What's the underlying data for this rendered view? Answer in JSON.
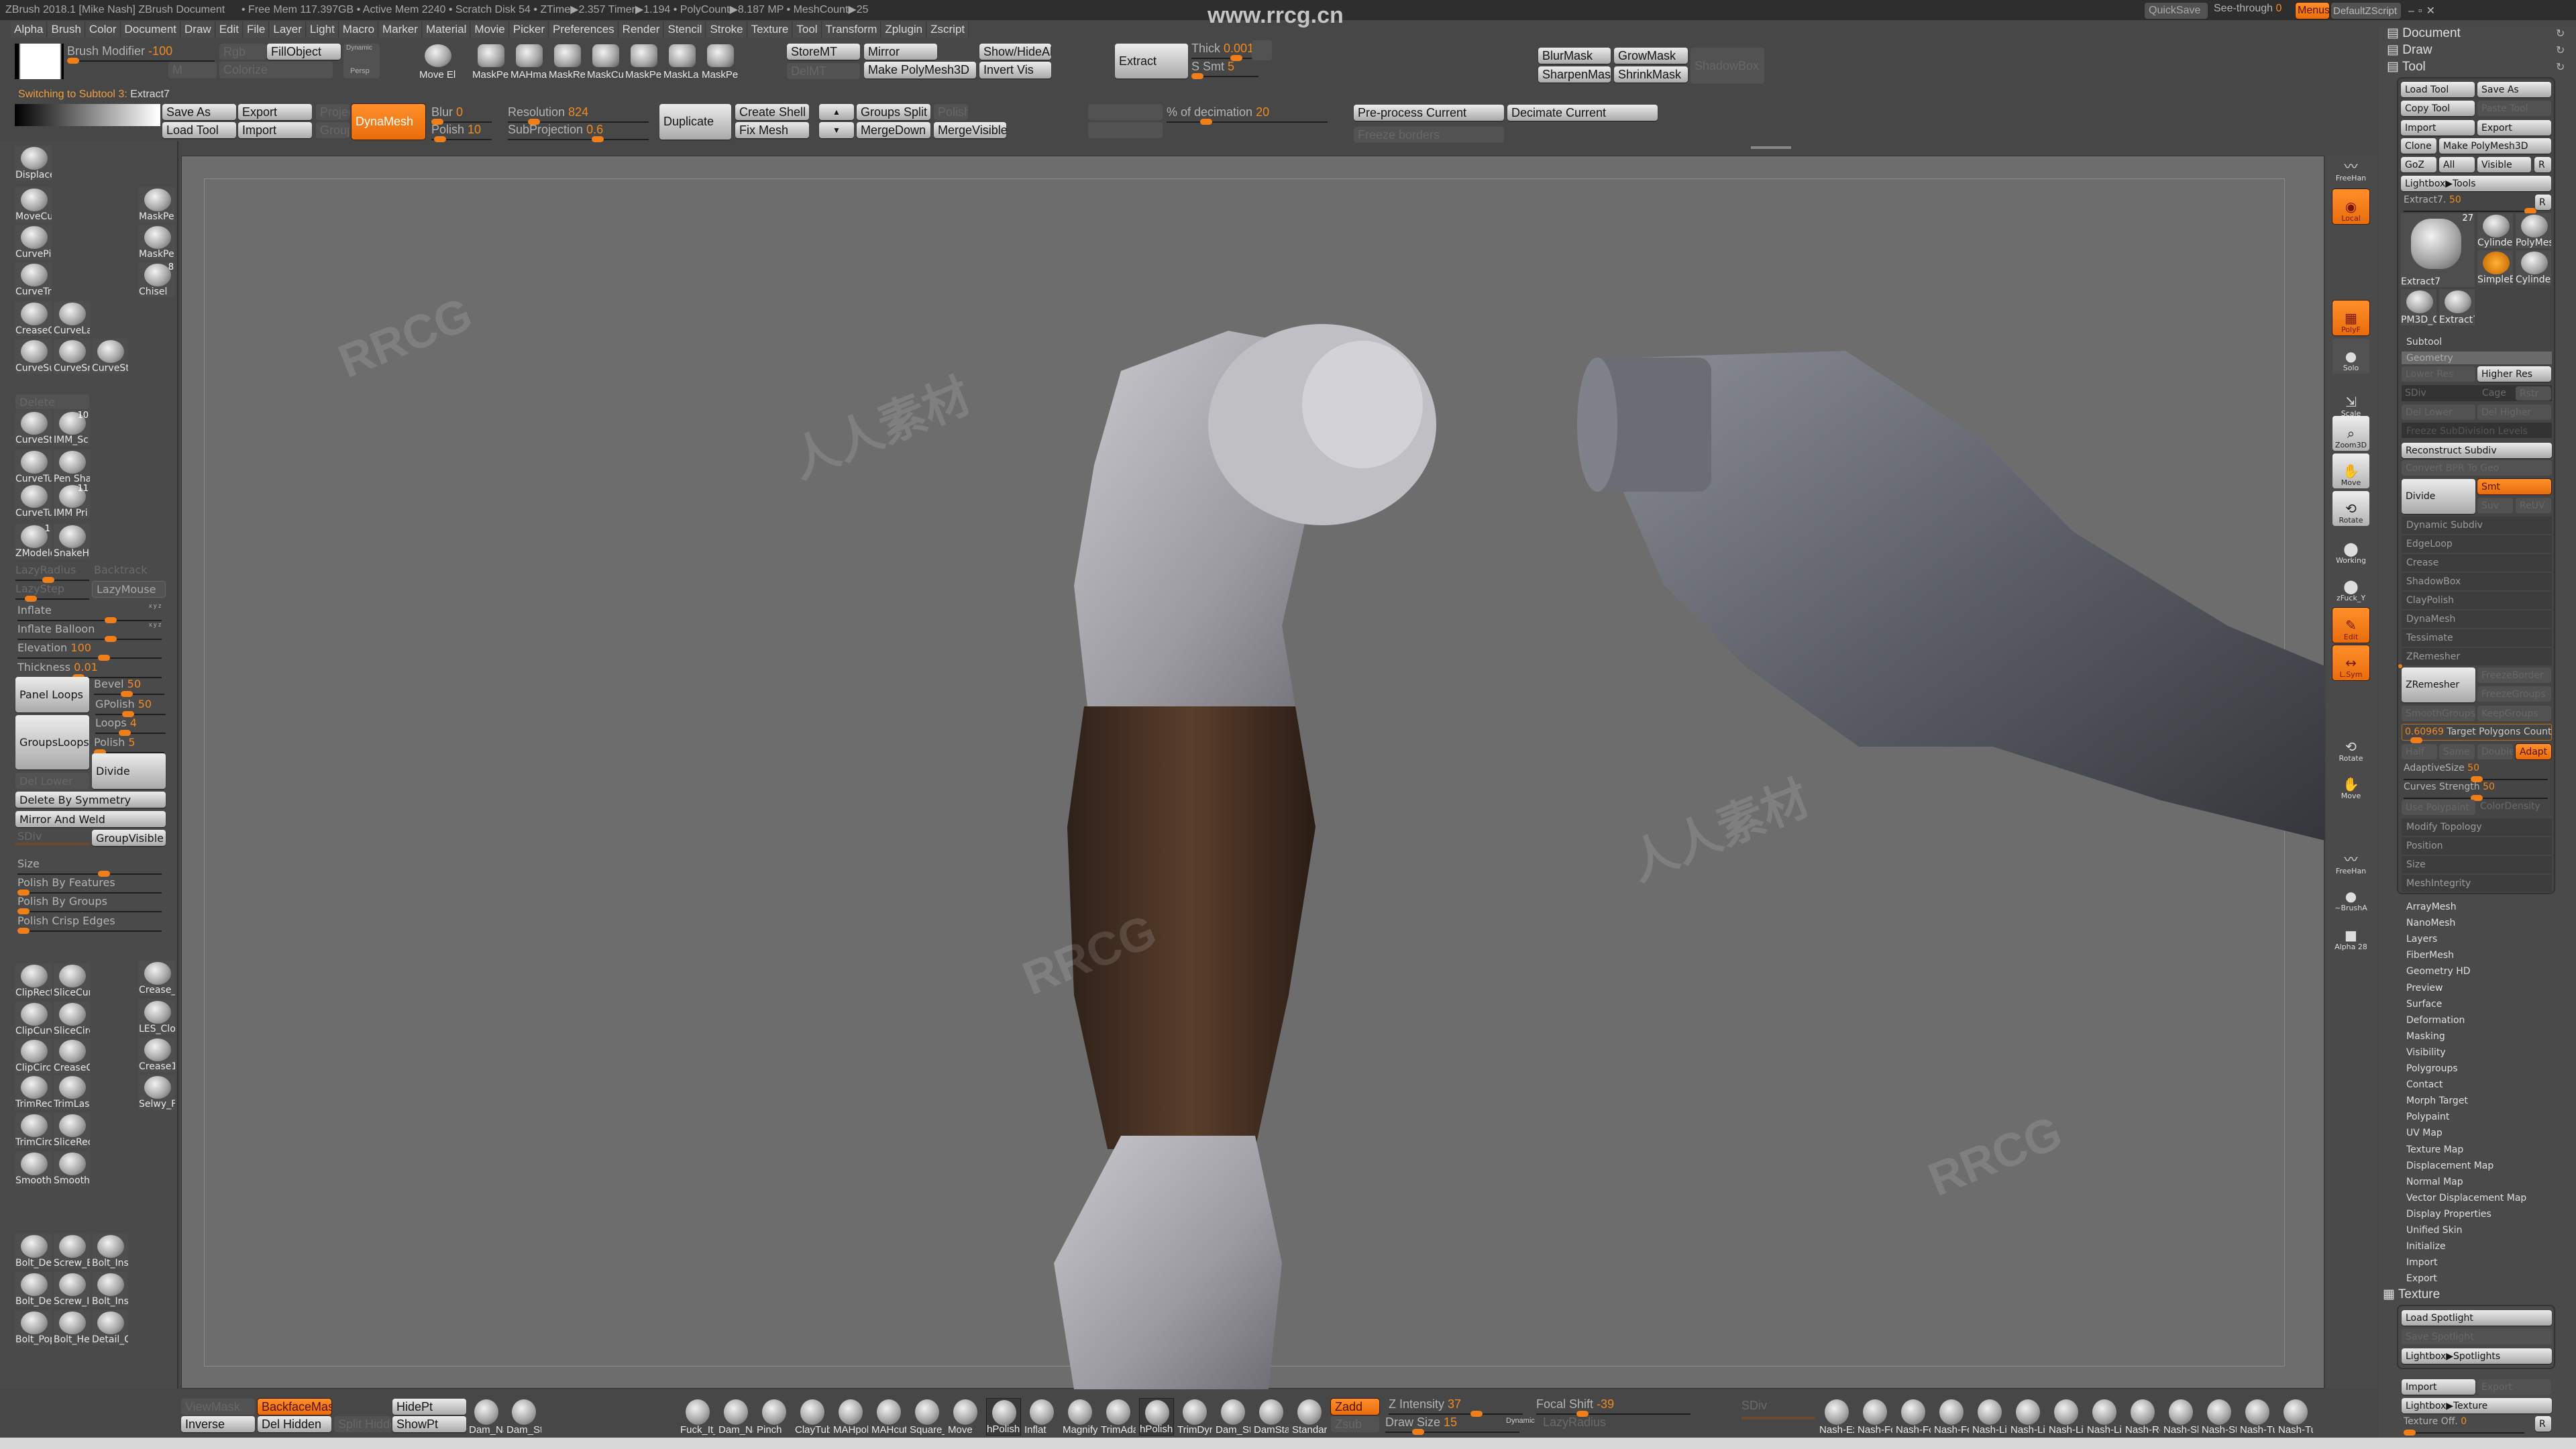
{
  "title_bar": {
    "text": "ZBrush 2018.1 [Mike Nash]   ZBrush Document",
    "stats": "• Free Mem 117.397GB • Active Mem 2240 • Scratch Disk 54 • ZTime▶2.357 Timer▶1.194 • PolyCount▶8.187 MP • MeshCount▶25",
    "watermark": "www.rrcg.cn",
    "quicksave": "QuickSave",
    "see_through_label": "See-through",
    "see_through_value": "0",
    "menus": "Menus",
    "default_zscript": "DefaultZScript"
  },
  "menu": [
    "Alpha",
    "Brush",
    "Color",
    "Document",
    "Draw",
    "Edit",
    "File",
    "Layer",
    "Light",
    "Macro",
    "Marker",
    "Material",
    "Movie",
    "Picker",
    "Preferences",
    "Render",
    "Stencil",
    "Stroke",
    "Texture",
    "Tool",
    "Transform",
    "Zplugin",
    "Zscript"
  ],
  "top_shelf": {
    "brush_modifier_label": "Brush Modifier",
    "brush_modifier_value": "-100",
    "rgb": "Rgb",
    "fill_object": "FillObject",
    "m": "M",
    "colorize": "Colorize",
    "persp_dynamic": "Dynamic",
    "persp": "Persp",
    "brushes": [
      "Move El",
      "MaskPe",
      "MAHma",
      "MaskRe",
      "MaskCu",
      "MaskPe",
      "MaskLa",
      "MaskPe"
    ],
    "store_mt": "StoreMT",
    "del_mt": "DelMT",
    "mirror": "Mirror",
    "make_polymesh": "Make PolyMesh3D",
    "show_hide_all": "Show/HideAll",
    "invert_vis": "Invert Vis",
    "extract": "Extract",
    "thick_label": "Thick",
    "thick_value": "0.0019",
    "s_smt_label": "S Smt",
    "s_smt_value": "5",
    "status": "Switching to Subtool 3:",
    "status_subtool": "Extract7",
    "save_as": "Save As",
    "export": "Export",
    "load_tool": "Load Tool",
    "import": "Import",
    "project": "Project",
    "groups": "Groups",
    "dynamesh": "DynaMesh",
    "blur_label": "Blur",
    "blur_value": "0",
    "polish_label": "Polish",
    "polish_value": "10",
    "resolution_label": "Resolution",
    "resolution_value": "824",
    "subprojection_label": "SubProjection",
    "subprojection_value": "0.6",
    "duplicate": "Duplicate",
    "create_shell": "Create Shell",
    "fix_mesh": "Fix Mesh",
    "arrow_up": "▲",
    "arrow_down": "▼",
    "groups_split": "Groups Split",
    "merge_down": "MergeDown",
    "polish_btn": "Polish",
    "merge_visible": "MergeVisible",
    "decimation_label": "% of decimation",
    "decimation_value": "20",
    "blur_mask": "BlurMask",
    "grow_mask": "GrowMask",
    "sharpen_mask": "SharpenMask",
    "shrink_mask": "ShrinkMask",
    "shadowbox": "ShadowBox",
    "preprocess": "Pre-process Current",
    "decimate": "Decimate Current",
    "freeze_borders": "Freeze borders"
  },
  "left_tray": {
    "brushes_top": [
      {
        "label": "Displace"
      },
      {
        "label": "MoveCu"
      },
      {
        "label": "MaskPe"
      },
      {
        "label": "CurvePi"
      },
      {
        "label": "MaskPe"
      },
      {
        "label": "CurveTr"
      },
      {
        "label": "Chisel",
        "badge": "8"
      },
      {
        "label": "CreaseC"
      },
      {
        "label": "CurveLa"
      },
      {
        "label": "CurveSu"
      },
      {
        "label": "CurveSn"
      },
      {
        "label": "CurveSt"
      }
    ],
    "delete": "Delete",
    "brushes_mid": [
      {
        "label": "CurveSt"
      },
      {
        "label": "IMM_Sc",
        "badge": "10"
      },
      {
        "label": "CurveTu"
      },
      {
        "label": "Pen Sha"
      },
      {
        "label": "CurveTu"
      },
      {
        "label": "IMM Pri",
        "badge": "11"
      },
      {
        "label": "ZModele",
        "badge": "1"
      },
      {
        "label": "SnakeHc"
      }
    ],
    "lazy_radius": "LazyRadius",
    "backtrack": "Backtrack",
    "lazy_step": "LazyStep",
    "lazy_mouse": "LazyMouse",
    "xyz": "x y z",
    "inflate": "Inflate",
    "inflate_balloon": "Inflate Balloon",
    "elevation_label": "Elevation",
    "elevation_value": "100",
    "thickness_label": "Thickness",
    "thickness_value": "0.01",
    "panel_loops": "Panel Loops",
    "bevel_label": "Bevel",
    "bevel_value": "50",
    "gpolish_label": "GPolish",
    "gpolish_value": "50",
    "groups_loops": "GroupsLoops",
    "loops_label": "Loops",
    "loops_value": "4",
    "polish_label": "Polish",
    "polish_value": "5",
    "divide": "Divide",
    "del_lower": "Del Lower",
    "delete_by_symmetry": "Delete By Symmetry",
    "mirror_and_weld": "Mirror And Weld",
    "sdiv": "SDiv",
    "group_visible": "GroupVisible",
    "size": "Size",
    "polish_by_features": "Polish By Features",
    "polish_by_groups": "Polish By Groups",
    "polish_crisp_edges": "Polish Crisp Edges",
    "brushes_clip": [
      {
        "label": "ClipRect"
      },
      {
        "label": "SliceCur"
      },
      {
        "label": "Crease_"
      },
      {
        "label": "ClipCurv"
      },
      {
        "label": "SliceCirc"
      },
      {
        "label": "LES_Clot"
      },
      {
        "label": "ClipCircl"
      },
      {
        "label": "CreaseC"
      },
      {
        "label": "Crease1"
      },
      {
        "label": "TrimRec"
      },
      {
        "label": "TrimLas"
      },
      {
        "label": "Selwy_F"
      },
      {
        "label": "TrimCirc"
      },
      {
        "label": "SliceRec"
      },
      {
        "label": "Smooth"
      },
      {
        "label": "Smooth"
      }
    ],
    "brushes_bolt": [
      {
        "label": "Bolt_Det"
      },
      {
        "label": "Screw_B"
      },
      {
        "label": "Bolt_Ins"
      },
      {
        "label": "Bolt_Det"
      },
      {
        "label": "Screw_In"
      },
      {
        "label": "Bolt_Ins"
      },
      {
        "label": "Bolt_Pop"
      },
      {
        "label": "Bolt_Hel"
      },
      {
        "label": "Detail_C"
      }
    ]
  },
  "right_shelf": [
    {
      "label": "FreeHan",
      "icon": "freehand-stroke-icon"
    },
    {
      "label": "Local",
      "icon": "local-symmetry-icon",
      "state": "on"
    },
    {
      "label": "PolyF",
      "icon": "polyframe-icon",
      "state": "on"
    },
    {
      "label": "Solo",
      "icon": "solo-icon"
    },
    {
      "label": "Scale",
      "icon": "scale-icon"
    },
    {
      "label": "Zoom3D",
      "icon": "zoom-icon"
    },
    {
      "label": "Move",
      "icon": "move-icon"
    },
    {
      "label": "Rotate",
      "icon": "rotate-icon"
    },
    {
      "label": "Working",
      "icon": "material-sphere-icon"
    },
    {
      "label": "zFuck_Y",
      "icon": "material-sphere-icon"
    },
    {
      "label": "Edit",
      "icon": "edit-icon",
      "state": "on"
    },
    {
      "label": "L.Sym",
      "icon": "local-symmetry-axis-icon",
      "state": "on"
    },
    {
      "label": "Rotate",
      "icon": "rotate-icon"
    },
    {
      "label": "Move",
      "icon": "move-icon"
    },
    {
      "label": "FreeHan",
      "icon": "freehand-stroke-icon"
    },
    {
      "label": "~BrushA",
      "icon": "brush-alpha-icon"
    },
    {
      "label": "Alpha 28",
      "icon": "alpha-icon"
    }
  ],
  "right_tray": {
    "palettes": [
      "Document",
      "Draw",
      "Tool"
    ],
    "tool": {
      "load_tool": "Load Tool",
      "save_as": "Save As",
      "copy_tool": "Copy Tool",
      "paste_tool": "Paste Tool",
      "import": "Import",
      "export": "Export",
      "clone": "Clone",
      "make_polymesh": "Make PolyMesh3D",
      "goz": "GoZ",
      "all": "All",
      "visible": "Visible",
      "r": "R",
      "lightbox_tools": "Lightbox▶Tools",
      "current_label": "Extract7.",
      "current_value": "50",
      "thumbs": [
        {
          "label": "Extract7",
          "badge": "27"
        },
        {
          "label": "Cylinder"
        },
        {
          "label": "PolyMes"
        },
        {
          "label": "SimpleB"
        },
        {
          "label": "Cylinder"
        },
        {
          "label": "PM3D_C"
        },
        {
          "label": "Extract7"
        }
      ]
    },
    "subtool": "Subtool",
    "geometry": "Geometry",
    "lower_res": "Lower Res",
    "higher_res": "Higher Res",
    "sdiv": "SDiv",
    "cage": "Cage",
    "rstr": "Rstr",
    "del_lower": "Del Lower",
    "del_higher": "Del Higher",
    "freeze_subdiv": "Freeze SubDivision Levels",
    "reconstruct_subdiv": "Reconstruct Subdiv",
    "convert_bpr": "Convert BPR To Geo",
    "divide": "Divide",
    "smt": "Smt",
    "suv": "Suv",
    "reuv": "ReUV",
    "geometry_items": [
      "Dynamic Subdiv",
      "EdgeLoop",
      "Crease",
      "ShadowBox",
      "ClayPolish",
      "DynaMesh",
      "Tessimate",
      "ZRemesher"
    ],
    "zremesher": "ZRemesher",
    "freeze_border": "FreezeBorder",
    "freeze_groups": "FreezeGroups",
    "smooth_groups": "SmoothGroups",
    "keep_groups": "KeepGroups",
    "target_value": "0.60969",
    "target_label": "Target Polygons Count",
    "half": "Half",
    "same": "Same",
    "double": "Double",
    "adapt": "Adapt",
    "adaptive_size_label": "AdaptiveSize",
    "adaptive_size_value": "50",
    "curves_strength_label": "Curves Strength",
    "curves_strength_value": "50",
    "use_polypaint": "Use Polypaint",
    "color_density": "ColorDensity",
    "geometry_tail": [
      "Modify Topology",
      "Position",
      "Size",
      "MeshIntegrity"
    ],
    "tool_sections": [
      "ArrayMesh",
      "NanoMesh",
      "Layers",
      "FiberMesh",
      "Geometry HD",
      "Preview",
      "Surface",
      "Deformation",
      "Masking",
      "Visibility",
      "Polygroups",
      "Contact",
      "Morph Target",
      "Polypaint",
      "UV Map",
      "Texture Map",
      "Displacement Map",
      "Normal Map",
      "Vector Displacement Map",
      "Display Properties",
      "Unified Skin",
      "Initialize",
      "Import",
      "Export"
    ],
    "texture": {
      "title": "Texture",
      "load_spotlight": "Load Spotlight",
      "save_spotlight": "Save Spotlight",
      "lightbox_spotlights": "Lightbox▶Spotlights",
      "import": "Import",
      "export": "Export",
      "lightbox_texture": "Lightbox▶Texture",
      "texture_off_label": "Texture Off.",
      "texture_off_value": "0",
      "r": "R"
    }
  },
  "bottom_shelf": {
    "view_mask": "ViewMask",
    "backface_mask": "BackfaceMask",
    "inverse": "Inverse",
    "del_hidden": "Del Hidden",
    "split_hidden": "Split Hidden",
    "hide_pt": "HidePt",
    "show_pt": "ShowPt",
    "brushes_a": [
      "Dam_Na",
      "Dam_Sta"
    ],
    "brushes_b": [
      "Fuck_It_(",
      "Dam_Na",
      "Pinch",
      "ClayTub",
      "MAHpol",
      "MAHcut",
      "Square_",
      "Move",
      "hPolish",
      "Inflat",
      "Magnify",
      "TrimAda",
      "hPolish",
      "TrimDyr",
      "Dam_St",
      "DamSta",
      "Standar"
    ],
    "zadd": "Zadd",
    "zsub": "Zsub",
    "z_intensity_label": "Z Intensity",
    "z_intensity_value": "37",
    "draw_size_label": "Draw Size",
    "draw_size_value": "15",
    "dynamic": "Dynamic",
    "focal_shift_label": "Focal Shift",
    "focal_shift_value": "-39",
    "lazy_radius": "LazyRadius",
    "sdiv": "SDiv",
    "nash_brushes": [
      "Nash-Ex",
      "Nash-Fo",
      "Nash-Fo",
      "Nash-Fo",
      "Nash-Li",
      "Nash-Li",
      "Nash-Li",
      "Nash-Li",
      "Nash-Ro",
      "Nash-Sl",
      "Nash-St",
      "Nash-Tu",
      "Nash-Tu"
    ]
  },
  "watermarks": [
    "RRCG",
    "人人素材"
  ],
  "colors": {
    "accent": "#f47a16",
    "ui_bg": "#474747",
    "canvas": "#6d6d6d",
    "forearm_brown": "#4a3426"
  }
}
